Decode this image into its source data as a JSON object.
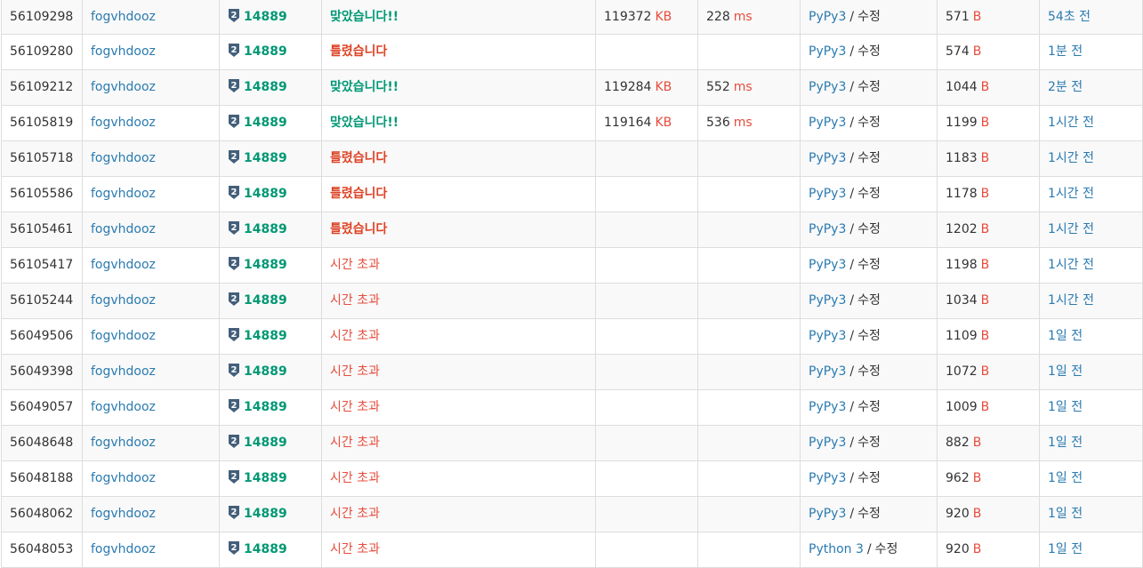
{
  "colors": {
    "link": "#2a7ab0",
    "accepted": "#009874",
    "wrong": "#dd4124",
    "tle": "#e74c3c",
    "unit": "#e74c3c",
    "tier_badge": "#435f7a"
  },
  "icons": {
    "tier": "silver-tier-2-shield-icon"
  },
  "units": {
    "memory": "KB",
    "time": "ms",
    "code": "B"
  },
  "separator": "/",
  "rows": [
    {
      "id": "56109298",
      "user": "fogvhdooz",
      "tier": "2",
      "problem": "14889",
      "result": "맞았습니다!!",
      "result_type": "ac",
      "memory": "119372",
      "time": "228",
      "lang": "PyPy3",
      "edit": "수정",
      "length": "571",
      "submitted": "54초 전"
    },
    {
      "id": "56109280",
      "user": "fogvhdooz",
      "tier": "2",
      "problem": "14889",
      "result": "틀렸습니다",
      "result_type": "wa",
      "memory": "",
      "time": "",
      "lang": "PyPy3",
      "edit": "수정",
      "length": "574",
      "submitted": "1분 전"
    },
    {
      "id": "56109212",
      "user": "fogvhdooz",
      "tier": "2",
      "problem": "14889",
      "result": "맞았습니다!!",
      "result_type": "ac",
      "memory": "119284",
      "time": "552",
      "lang": "PyPy3",
      "edit": "수정",
      "length": "1044",
      "submitted": "2분 전"
    },
    {
      "id": "56105819",
      "user": "fogvhdooz",
      "tier": "2",
      "problem": "14889",
      "result": "맞았습니다!!",
      "result_type": "ac",
      "memory": "119164",
      "time": "536",
      "lang": "PyPy3",
      "edit": "수정",
      "length": "1199",
      "submitted": "1시간 전"
    },
    {
      "id": "56105718",
      "user": "fogvhdooz",
      "tier": "2",
      "problem": "14889",
      "result": "틀렸습니다",
      "result_type": "wa",
      "memory": "",
      "time": "",
      "lang": "PyPy3",
      "edit": "수정",
      "length": "1183",
      "submitted": "1시간 전"
    },
    {
      "id": "56105586",
      "user": "fogvhdooz",
      "tier": "2",
      "problem": "14889",
      "result": "틀렸습니다",
      "result_type": "wa",
      "memory": "",
      "time": "",
      "lang": "PyPy3",
      "edit": "수정",
      "length": "1178",
      "submitted": "1시간 전"
    },
    {
      "id": "56105461",
      "user": "fogvhdooz",
      "tier": "2",
      "problem": "14889",
      "result": "틀렸습니다",
      "result_type": "wa",
      "memory": "",
      "time": "",
      "lang": "PyPy3",
      "edit": "수정",
      "length": "1202",
      "submitted": "1시간 전"
    },
    {
      "id": "56105417",
      "user": "fogvhdooz",
      "tier": "2",
      "problem": "14889",
      "result": "시간 초과",
      "result_type": "tle",
      "memory": "",
      "time": "",
      "lang": "PyPy3",
      "edit": "수정",
      "length": "1198",
      "submitted": "1시간 전"
    },
    {
      "id": "56105244",
      "user": "fogvhdooz",
      "tier": "2",
      "problem": "14889",
      "result": "시간 초과",
      "result_type": "tle",
      "memory": "",
      "time": "",
      "lang": "PyPy3",
      "edit": "수정",
      "length": "1034",
      "submitted": "1시간 전"
    },
    {
      "id": "56049506",
      "user": "fogvhdooz",
      "tier": "2",
      "problem": "14889",
      "result": "시간 초과",
      "result_type": "tle",
      "memory": "",
      "time": "",
      "lang": "PyPy3",
      "edit": "수정",
      "length": "1109",
      "submitted": "1일 전"
    },
    {
      "id": "56049398",
      "user": "fogvhdooz",
      "tier": "2",
      "problem": "14889",
      "result": "시간 초과",
      "result_type": "tle",
      "memory": "",
      "time": "",
      "lang": "PyPy3",
      "edit": "수정",
      "length": "1072",
      "submitted": "1일 전"
    },
    {
      "id": "56049057",
      "user": "fogvhdooz",
      "tier": "2",
      "problem": "14889",
      "result": "시간 초과",
      "result_type": "tle",
      "memory": "",
      "time": "",
      "lang": "PyPy3",
      "edit": "수정",
      "length": "1009",
      "submitted": "1일 전"
    },
    {
      "id": "56048648",
      "user": "fogvhdooz",
      "tier": "2",
      "problem": "14889",
      "result": "시간 초과",
      "result_type": "tle",
      "memory": "",
      "time": "",
      "lang": "PyPy3",
      "edit": "수정",
      "length": "882",
      "submitted": "1일 전"
    },
    {
      "id": "56048188",
      "user": "fogvhdooz",
      "tier": "2",
      "problem": "14889",
      "result": "시간 초과",
      "result_type": "tle",
      "memory": "",
      "time": "",
      "lang": "PyPy3",
      "edit": "수정",
      "length": "962",
      "submitted": "1일 전"
    },
    {
      "id": "56048062",
      "user": "fogvhdooz",
      "tier": "2",
      "problem": "14889",
      "result": "시간 초과",
      "result_type": "tle",
      "memory": "",
      "time": "",
      "lang": "PyPy3",
      "edit": "수정",
      "length": "920",
      "submitted": "1일 전"
    },
    {
      "id": "56048053",
      "user": "fogvhdooz",
      "tier": "2",
      "problem": "14889",
      "result": "시간 초과",
      "result_type": "tle",
      "memory": "",
      "time": "",
      "lang": "Python 3",
      "edit": "수정",
      "length": "920",
      "submitted": "1일 전"
    }
  ]
}
